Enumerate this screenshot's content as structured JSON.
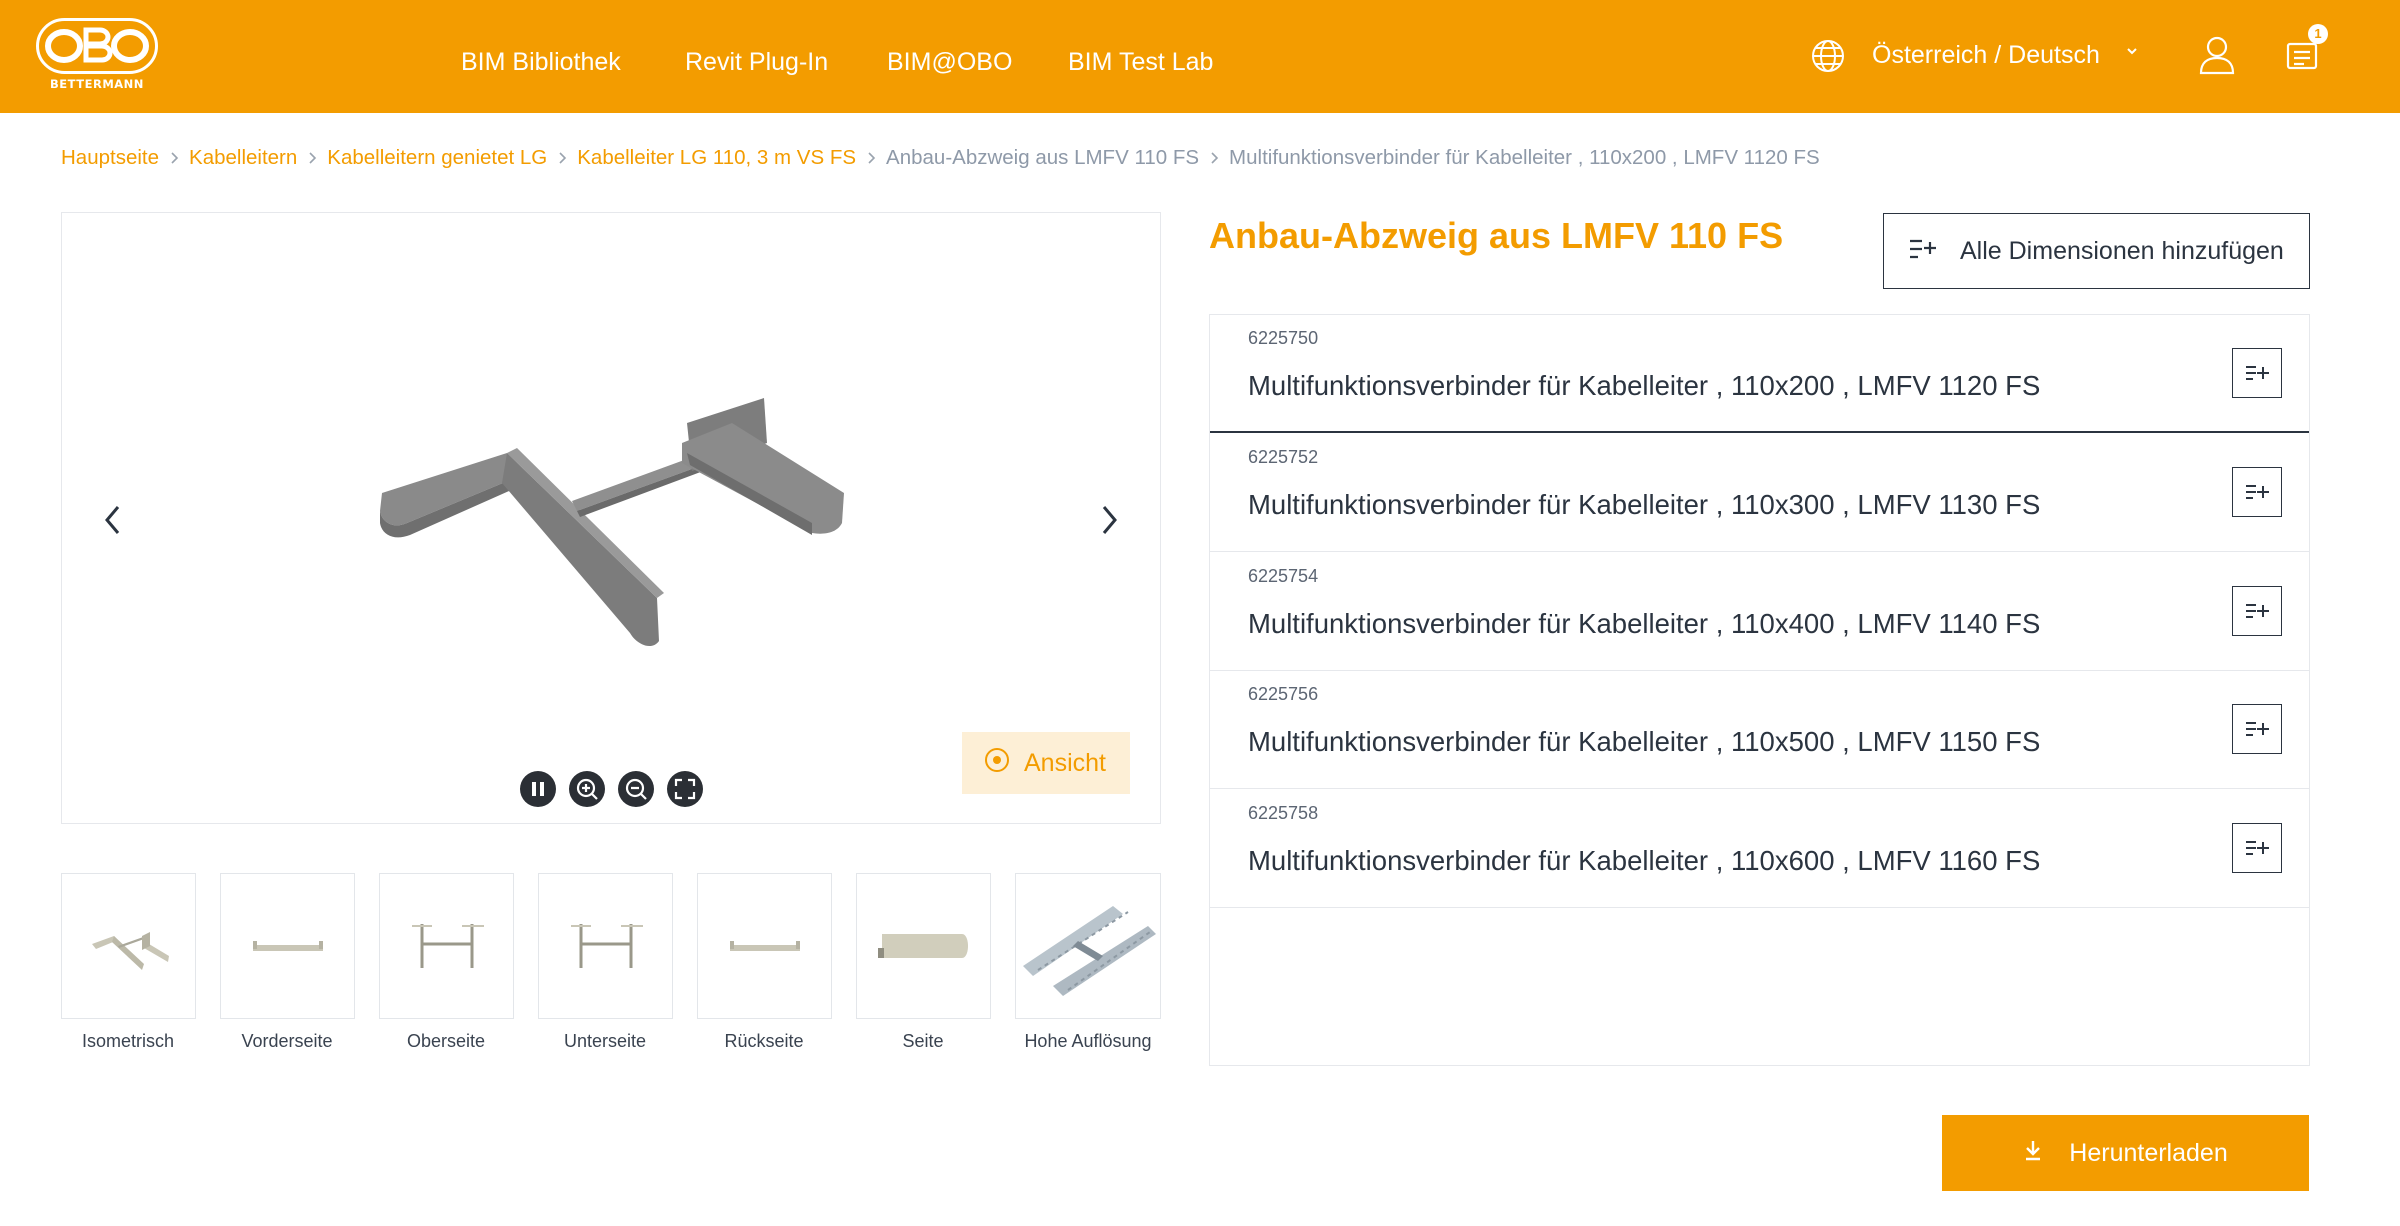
{
  "brand": {
    "logo_text": "OBO",
    "logo_subtext": "BETTERMANN",
    "accent": "#f39c00"
  },
  "nav": {
    "items": [
      {
        "label": "BIM Bibliothek"
      },
      {
        "label": "Revit Plug-In"
      },
      {
        "label": "BIM@OBO"
      },
      {
        "label": "BIM Test Lab"
      }
    ]
  },
  "header": {
    "language_label": "Österreich / Deutsch",
    "cart_count": "1",
    "icons": [
      "globe-icon",
      "chevron-down-icon",
      "user-icon",
      "list-cart-icon"
    ]
  },
  "breadcrumb": [
    {
      "label": "Hauptseite"
    },
    {
      "label": "Kabelleitern"
    },
    {
      "label": "Kabelleitern genietet LG"
    },
    {
      "label": "Kabelleiter LG 110, 3 m VS FS"
    },
    {
      "label": "Anbau-Abzweig aus LMFV 110 FS"
    },
    {
      "label": "Multifunktionsverbinder für Kabelleiter , 110x200 , LMFV 1120 FS"
    }
  ],
  "viewer": {
    "view_button_label": "Ansicht",
    "controls": [
      "pause-icon",
      "zoom-in-icon",
      "zoom-out-icon",
      "fullscreen-icon"
    ]
  },
  "thumbnails": [
    {
      "label": "Isometrisch"
    },
    {
      "label": "Vorderseite"
    },
    {
      "label": "Oberseite"
    },
    {
      "label": "Unterseite"
    },
    {
      "label": "Rückseite"
    },
    {
      "label": "Seite"
    },
    {
      "label": "Hohe Auflösung"
    }
  ],
  "product": {
    "title": "Anbau-Abzweig aus LMFV 110 FS",
    "add_all_label": "Alle Dimensionen hinzufügen",
    "variants": [
      {
        "code": "6225750",
        "name": "Multifunktionsverbinder für Kabelleiter , 110x200 , LMFV 1120 FS",
        "selected": true
      },
      {
        "code": "6225752",
        "name": "Multifunktionsverbinder für Kabelleiter , 110x300 , LMFV 1130 FS",
        "selected": false
      },
      {
        "code": "6225754",
        "name": "Multifunktionsverbinder für Kabelleiter , 110x400 , LMFV 1140 FS",
        "selected": false
      },
      {
        "code": "6225756",
        "name": "Multifunktionsverbinder für Kabelleiter , 110x500 , LMFV 1150 FS",
        "selected": false
      },
      {
        "code": "6225758",
        "name": "Multifunktionsverbinder für Kabelleiter , 110x600 , LMFV 1160 FS",
        "selected": false
      }
    ]
  },
  "download": {
    "label": "Herunterladen"
  }
}
